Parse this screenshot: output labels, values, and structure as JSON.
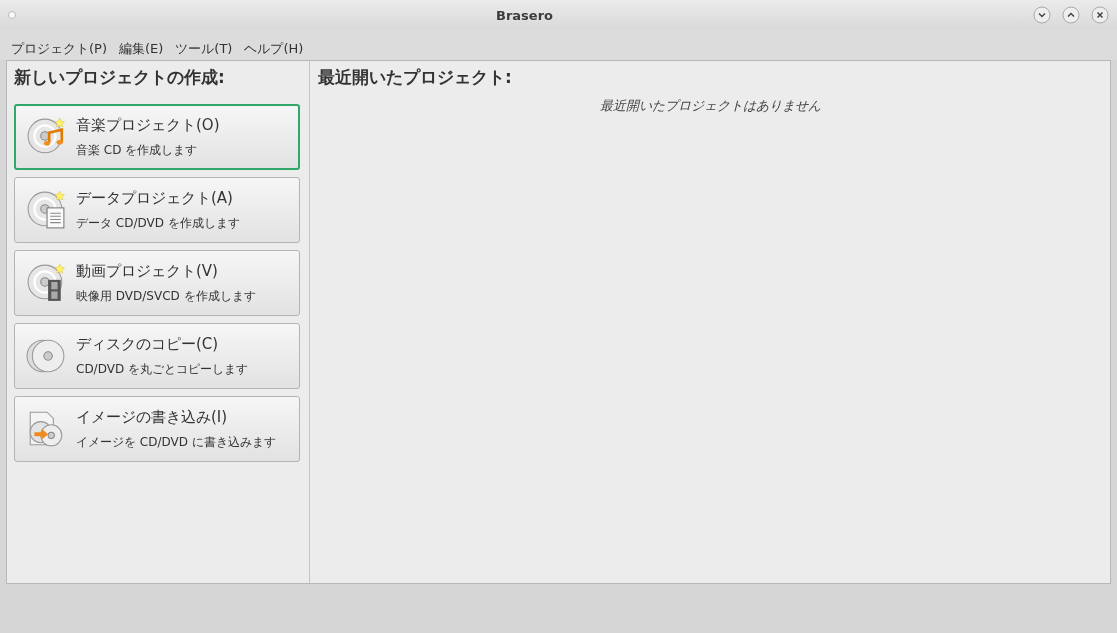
{
  "window": {
    "title": "Brasero"
  },
  "menu": [
    "プロジェクト(P)",
    "編集(E)",
    "ツール(T)",
    "ヘルプ(H)"
  ],
  "new_project": {
    "heading": "新しいプロジェクトの作成:",
    "buttons": [
      {
        "kind": "music",
        "label": "音楽プロジェクト(O)",
        "description": "音楽 CD を作成します",
        "selected": true
      },
      {
        "kind": "data",
        "label": "データプロジェクト(A)",
        "description": "データ CD/DVD を作成します",
        "selected": false
      },
      {
        "kind": "video",
        "label": "動画プロジェクト(V)",
        "description": "映像用 DVD/SVCD を作成します",
        "selected": false
      },
      {
        "kind": "copy",
        "label": "ディスクのコピー(C)",
        "description": "CD/DVD を丸ごとコピーします",
        "selected": false
      },
      {
        "kind": "image",
        "label": "イメージの書き込み(I)",
        "description": "イメージを CD/DVD に書き込みます",
        "selected": false
      }
    ]
  },
  "recent": {
    "heading": "最近開いたプロジェクト:",
    "empty_message": "最近開いたプロジェクトはありません"
  }
}
